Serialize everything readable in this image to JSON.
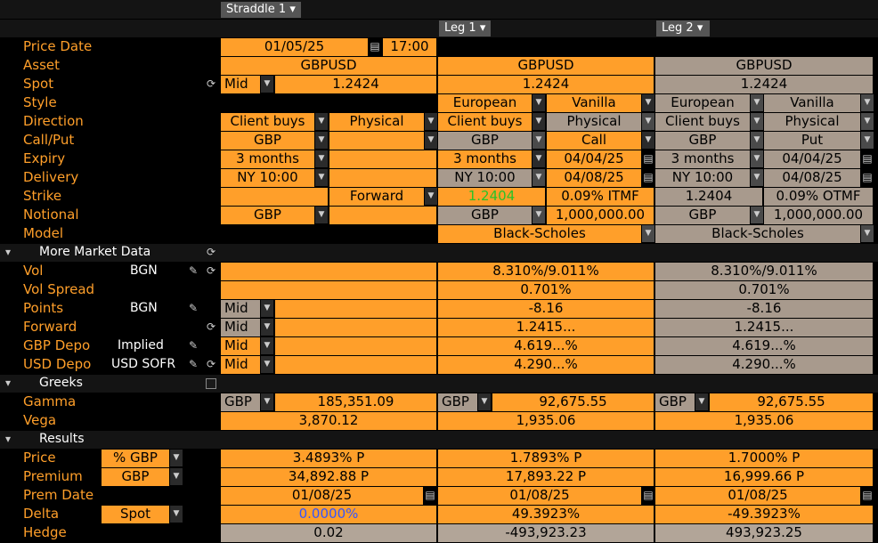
{
  "header": {
    "straddle": "Straddle 1",
    "leg1": "Leg 1",
    "leg2": "Leg 2"
  },
  "labels": {
    "price_date": "Price Date",
    "asset": "Asset",
    "spot": "Spot",
    "style": "Style",
    "direction": "Direction",
    "callput": "Call/Put",
    "expiry": "Expiry",
    "delivery": "Delivery",
    "strike": "Strike",
    "notional": "Notional",
    "model": "Model",
    "more_market": "More Market Data",
    "vol": "Vol",
    "vol_spread": "Vol Spread",
    "points": "Points",
    "forward": "Forward",
    "gbp_depo": "GBP Depo",
    "usd_depo": "USD Depo",
    "greeks": "Greeks",
    "gamma": "Gamma",
    "vega": "Vega",
    "results": "Results",
    "price": "Price",
    "premium": "Premium",
    "prem_date": "Prem Date",
    "delta": "Delta",
    "hedge": "Hedge"
  },
  "sources": {
    "vol": "BGN",
    "points": "BGN",
    "gbp_depo": "Implied",
    "usd_depo": "USD SOFR"
  },
  "selectors": {
    "price_unit": "% GBP",
    "premium_unit": "GBP",
    "delta_type": "Spot",
    "mid": "Mid"
  },
  "main": {
    "date": "01/05/25",
    "time": "17:00",
    "asset": "GBPUSD",
    "spot_mode": "Mid",
    "spot": "1.2424",
    "direction": "Client buys",
    "settle": "Physical",
    "callput": "GBP",
    "expiry": "3 months",
    "delivery": "NY 10:00",
    "strike_mode": "Forward",
    "notional_ccy": "GBP",
    "gamma_ccy": "GBP",
    "gamma": "185,351.09",
    "vega": "3,870.12",
    "price": "3.4893% P",
    "premium": "34,892.88 P",
    "prem_date": "01/08/25",
    "delta": "0.0000%",
    "hedge": "0.02"
  },
  "leg1": {
    "asset": "GBPUSD",
    "spot": "1.2424",
    "style": "European",
    "type": "Vanilla",
    "direction": "Client buys",
    "settle": "Physical",
    "ccy": "GBP",
    "cp": "Call",
    "expiry": "3 months",
    "expiry_date": "04/04/25",
    "delivery": "NY 10:00",
    "delivery_date": "04/08/25",
    "strike": "1.2404",
    "moneyness": "0.09% ITMF",
    "notional_ccy": "GBP",
    "notional": "1,000,000.00",
    "model": "Black-Scholes",
    "vol": "8.310%/9.011%",
    "vol_spread": "0.701%",
    "points": "-8.16",
    "forward": "1.2415...",
    "gbp_depo": "4.619...%",
    "usd_depo": "4.290...%",
    "gamma_ccy": "GBP",
    "gamma": "92,675.55",
    "vega": "1,935.06",
    "price": "1.7893% P",
    "premium": "17,893.22 P",
    "prem_date": "01/08/25",
    "delta": "49.3923%",
    "hedge": "-493,923.23"
  },
  "leg2": {
    "asset": "GBPUSD",
    "spot": "1.2424",
    "style": "European",
    "type": "Vanilla",
    "direction": "Client buys",
    "settle": "Physical",
    "ccy": "GBP",
    "cp": "Put",
    "expiry": "3 months",
    "expiry_date": "04/04/25",
    "delivery": "NY 10:00",
    "delivery_date": "04/08/25",
    "strike": "1.2404",
    "moneyness": "0.09% OTMF",
    "notional_ccy": "GBP",
    "notional": "1,000,000.00",
    "model": "Black-Scholes",
    "vol": "8.310%/9.011%",
    "vol_spread": "0.701%",
    "points": "-8.16",
    "forward": "1.2415...",
    "gbp_depo": "4.619...%",
    "usd_depo": "4.290...%",
    "gamma_ccy": "GBP",
    "gamma": "92,675.55",
    "vega": "1,935.06",
    "price": "1.7000% P",
    "premium": "16,999.66 P",
    "prem_date": "01/08/25",
    "delta": "-49.3923%",
    "hedge": "493,923.25"
  },
  "colors": {
    "orange": "#ff9f2a",
    "gray": "#a89a8d",
    "green": "#29c229",
    "blue": "#3355ff"
  },
  "icons": {
    "refresh": "refresh-icon",
    "pencil": "pencil-icon",
    "calendar": "calendar-icon",
    "dropdown": "chevron-down-icon",
    "collapse": "triangle-down-icon"
  }
}
